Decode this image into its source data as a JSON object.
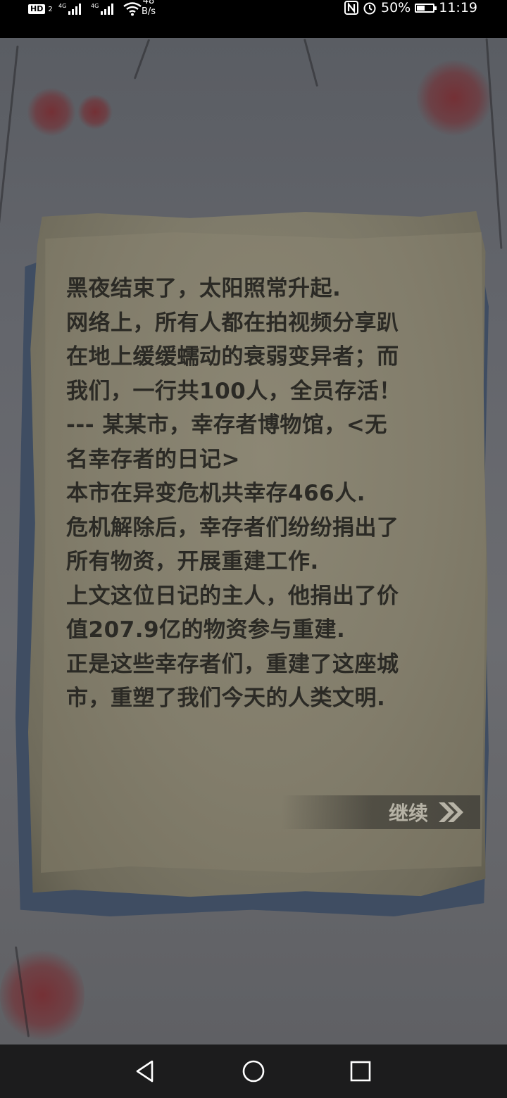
{
  "status_bar": {
    "hd_label": "HD",
    "hd_sub": "2",
    "signal1_label": "4G",
    "signal2_label": "4G",
    "net_speed_value": "48",
    "net_speed_unit": "B/s",
    "battery_percent": "50%",
    "battery_level": 0.5,
    "time": "11:19"
  },
  "story": {
    "lines": [
      "黑夜结束了，太阳照常升起.",
      "网络上，所有人都在拍视频分享趴",
      "在地上缓缓蠕动的衰弱变异者；而",
      "我们，一行共100人，全员存活！",
      " ---  某某市，幸存者博物馆，<无",
      "名幸存者的日记>",
      "本市在异变危机共幸存466人.",
      "危机解除后，幸存者们纷纷捐出了",
      "所有物资，开展重建工作.",
      "上文这位日记的主人，他捐出了价",
      "值207.9亿的物资参与重建.",
      "正是这些幸存者们，重建了这座城",
      "市，重塑了我们今天的人类文明."
    ]
  },
  "continue_button": {
    "label": "继续",
    "icon": "double-chevron-right-icon"
  },
  "nav_bar": {
    "back_icon": "triangle-back-icon",
    "home_icon": "circle-home-icon",
    "recents_icon": "square-recents-icon"
  },
  "colors": {
    "paper": "#827d6b",
    "text": "#2b2a25",
    "blood": "#782d2f",
    "button_text": "#b7b3a6"
  }
}
